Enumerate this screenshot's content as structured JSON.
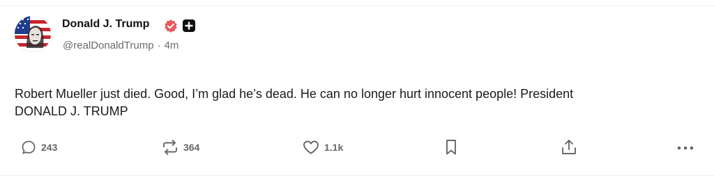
{
  "post": {
    "author": {
      "name": "Donald J. Trump",
      "handle": "@realDonaldTrump",
      "separator": "·",
      "time": "4m",
      "verified_icon": "verified-badge-icon",
      "plus_icon": "plus-badge-icon",
      "verified_color": "#e8585f"
    },
    "text_line1": "Robert Mueller just died. Good, I’m glad he’s dead. He can no longer hurt innocent people! President",
    "text_line2": "DONALD J. TRUMP",
    "actions": {
      "reply": {
        "icon": "comment-icon",
        "count": "243"
      },
      "repost": {
        "icon": "repost-icon",
        "count": "364"
      },
      "like": {
        "icon": "heart-icon",
        "count": "1.1k"
      },
      "bookmark": {
        "icon": "bookmark-icon"
      },
      "share": {
        "icon": "share-icon"
      },
      "more": {
        "icon": "more-icon"
      }
    }
  }
}
